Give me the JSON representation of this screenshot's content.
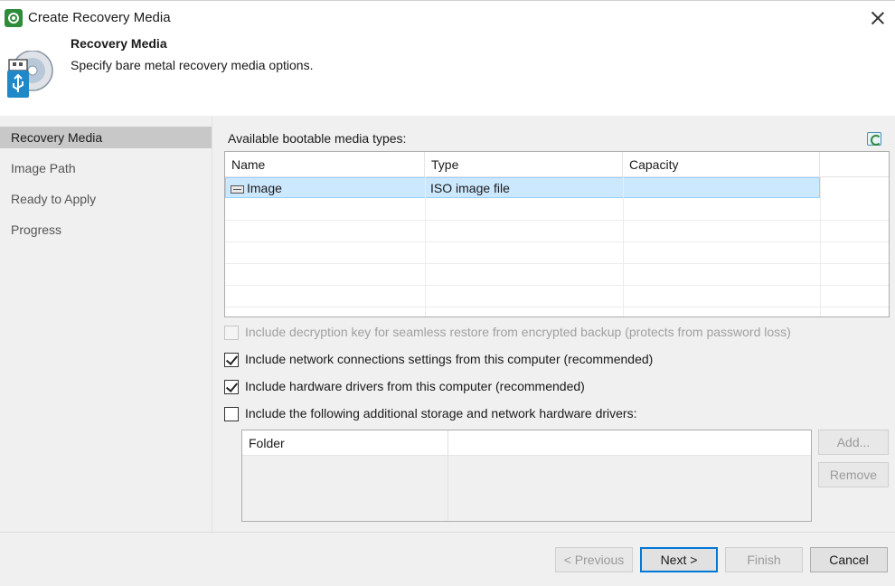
{
  "window": {
    "title": "Create Recovery Media"
  },
  "header": {
    "title": "Recovery Media",
    "subtitle": "Specify bare metal recovery media options."
  },
  "sidebar": {
    "items": [
      {
        "label": "Recovery Media",
        "active": true
      },
      {
        "label": "Image Path",
        "active": false
      },
      {
        "label": "Ready to Apply",
        "active": false
      },
      {
        "label": "Progress",
        "active": false
      }
    ]
  },
  "media": {
    "label": "Available bootable media types:",
    "columns": [
      "Name",
      "Type",
      "Capacity"
    ],
    "rows": [
      {
        "name": "Image",
        "type": "ISO image file",
        "capacity": ""
      }
    ]
  },
  "options": [
    {
      "label": "Include decryption key for seamless restore from encrypted backup (protects from password loss)",
      "checked": false,
      "disabled": true
    },
    {
      "label": "Include network connections settings from this computer (recommended)",
      "checked": true,
      "disabled": false
    },
    {
      "label": "Include hardware drivers from this computer (recommended)",
      "checked": true,
      "disabled": false
    },
    {
      "label": "Include the following additional storage and network hardware drivers:",
      "checked": false,
      "disabled": false
    }
  ],
  "drivers": {
    "columns": [
      "Folder",
      ""
    ],
    "add_label": "Add...",
    "remove_label": "Remove"
  },
  "footer": {
    "previous_label": "< Previous",
    "next_label": "Next >",
    "finish_label": "Finish",
    "cancel_label": "Cancel"
  },
  "colors": {
    "accent": "#0078d7",
    "selection": "#cce8ff",
    "panel": "#f0f0f0"
  }
}
